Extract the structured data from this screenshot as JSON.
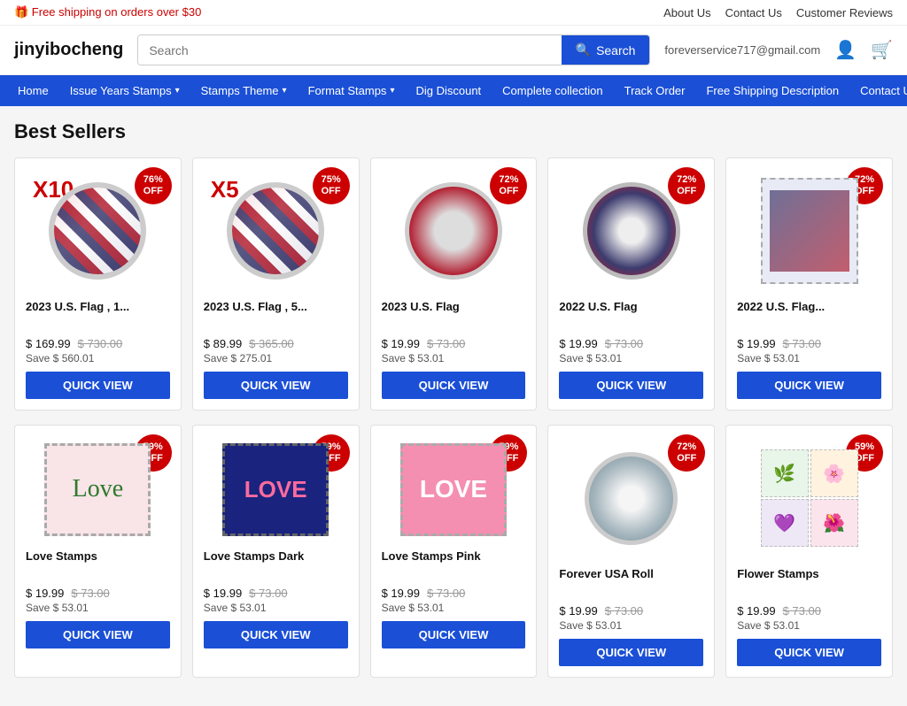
{
  "topbar": {
    "shipping_text": "🎁 Free shipping on orders over $30",
    "links": [
      "About Us",
      "Contact Us",
      "Customer Reviews"
    ]
  },
  "header": {
    "logo": "jinyibocheng",
    "search_placeholder": "Search",
    "search_button": "Search",
    "email": "foreverservice717@gmail.com"
  },
  "nav": {
    "items": [
      {
        "label": "Home",
        "has_dropdown": false
      },
      {
        "label": "Issue Years Stamps",
        "has_dropdown": true
      },
      {
        "label": "Stamps Theme",
        "has_dropdown": true
      },
      {
        "label": "Format Stamps",
        "has_dropdown": true
      },
      {
        "label": "Dig Discount",
        "has_dropdown": false
      },
      {
        "label": "Complete collection",
        "has_dropdown": false
      },
      {
        "label": "Track Order",
        "has_dropdown": false
      },
      {
        "label": "Free Shipping Description",
        "has_dropdown": false
      },
      {
        "label": "Contact Us",
        "has_dropdown": false
      }
    ]
  },
  "main": {
    "section_title": "Best Sellers",
    "products_row1": [
      {
        "id": "p1",
        "title": "2023 U.S. Flag , 1...",
        "badge_pct": "76%",
        "badge_off": "OFF",
        "x_label": "X10",
        "price_current": "$ 169.99",
        "price_original": "$ 730.00",
        "save": "Save $ 560.01",
        "type": "roll"
      },
      {
        "id": "p2",
        "title": "2023 U.S. Flag , 5...",
        "badge_pct": "75%",
        "badge_off": "OFF",
        "x_label": "X5",
        "price_current": "$ 89.99",
        "price_original": "$ 365.00",
        "save": "Save $ 275.01",
        "type": "roll"
      },
      {
        "id": "p3",
        "title": "2023 U.S. Flag",
        "badge_pct": "72%",
        "badge_off": "OFF",
        "x_label": "",
        "price_current": "$ 19.99",
        "price_original": "$ 73.00",
        "save": "Save $ 53.01",
        "type": "roll_single"
      },
      {
        "id": "p4",
        "title": "2022 U.S. Flag",
        "badge_pct": "72%",
        "badge_off": "OFF",
        "x_label": "",
        "price_current": "$ 19.99",
        "price_original": "$ 73.00",
        "save": "Save $ 53.01",
        "type": "roll_single"
      },
      {
        "id": "p5",
        "title": "2022 U.S. Flag...",
        "badge_pct": "72%",
        "badge_off": "OFF",
        "x_label": "",
        "price_current": "$ 19.99",
        "price_original": "$ 73.00",
        "save": "Save $ 53.01",
        "type": "stamp_perforated"
      }
    ],
    "products_row2": [
      {
        "id": "p6",
        "title": "Love Stamps",
        "badge_pct": "59%",
        "badge_off": "OFF",
        "price_current": "$ 19.99",
        "price_original": "$ 73.00",
        "save": "Save $ 53.01",
        "type": "love_floral"
      },
      {
        "id": "p7",
        "title": "Love Stamps Dark",
        "badge_pct": "59%",
        "badge_off": "OFF",
        "price_current": "$ 19.99",
        "price_original": "$ 73.00",
        "save": "Save $ 53.01",
        "type": "love_dark"
      },
      {
        "id": "p8",
        "title": "Love Stamps Pink",
        "badge_pct": "59%",
        "badge_off": "OFF",
        "price_current": "$ 19.99",
        "price_original": "$ 73.00",
        "save": "Save $ 53.01",
        "type": "love_pink"
      },
      {
        "id": "p9",
        "title": "Forever USA Roll",
        "badge_pct": "72%",
        "badge_off": "OFF",
        "price_current": "$ 19.99",
        "price_original": "$ 73.00",
        "save": "Save $ 53.01",
        "type": "roll_plain"
      },
      {
        "id": "p10",
        "title": "Flower Stamps",
        "badge_pct": "59%",
        "badge_off": "OFF",
        "price_current": "$ 19.99",
        "price_original": "$ 73.00",
        "save": "Save $ 53.01",
        "type": "flower_grid"
      }
    ],
    "quick_view_label": "QUICK VIEW"
  }
}
